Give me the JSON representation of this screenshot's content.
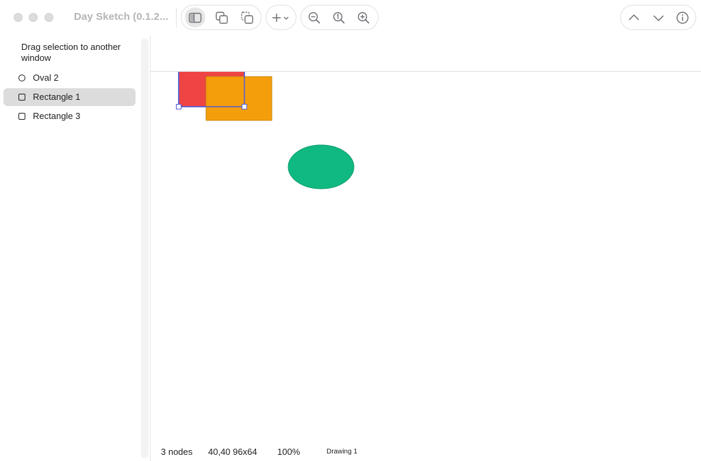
{
  "window": {
    "title": "Day Sketch (0.1.2..."
  },
  "toolbar": {
    "buttons": [
      {
        "name": "sidebar-toggle",
        "icon": "sidebar-icon",
        "active": true
      },
      {
        "name": "duplicate",
        "icon": "duplicate-icon",
        "active": false
      },
      {
        "name": "paste",
        "icon": "paste-icon",
        "active": false
      },
      {
        "name": "add-shape",
        "icon": "plus-icon",
        "active": false
      },
      {
        "name": "zoom-out",
        "icon": "zoom-out-icon",
        "active": false
      },
      {
        "name": "zoom-actual",
        "icon": "zoom-actual-icon",
        "active": false
      },
      {
        "name": "zoom-in",
        "icon": "zoom-in-icon",
        "active": false
      },
      {
        "name": "previous",
        "icon": "chevron-up-icon",
        "active": false
      },
      {
        "name": "next",
        "icon": "chevron-down-icon",
        "active": false
      },
      {
        "name": "info",
        "icon": "info-icon",
        "active": false
      }
    ]
  },
  "sidebar": {
    "note": "Drag selection to another window",
    "layers": [
      {
        "label": "Oval 2",
        "icon": "oval-icon",
        "selected": false
      },
      {
        "label": "Rectangle 1",
        "icon": "rectangle-icon",
        "selected": true
      },
      {
        "label": "Rectangle 3",
        "icon": "rectangle-icon",
        "selected": false
      }
    ]
  },
  "canvas": {
    "shapes": [
      {
        "name": "Rectangle 1",
        "kind": "rect",
        "fill": "#ef4444",
        "selected": true
      },
      {
        "name": "Rectangle 3",
        "kind": "rect",
        "fill": "#f59e0b",
        "selected": false
      },
      {
        "name": "Oval 2",
        "kind": "oval",
        "fill": "#10b981",
        "selected": false
      }
    ],
    "selection_color": "#4f5fd6"
  },
  "status": {
    "node_count": "3 nodes",
    "selection_geometry": "40,40 96x64",
    "zoom": "100%",
    "document": "Drawing 1"
  }
}
